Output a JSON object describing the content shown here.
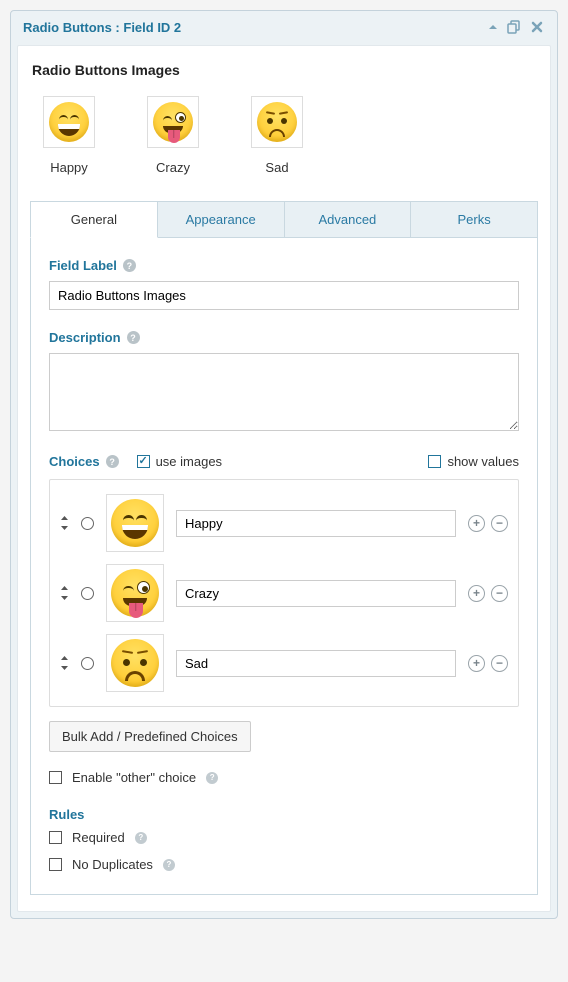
{
  "header": {
    "title": "Radio Buttons : Field ID 2"
  },
  "field": {
    "title": "Radio Buttons Images"
  },
  "preview": {
    "items": [
      {
        "label": "Happy",
        "icon": "happy"
      },
      {
        "label": "Crazy",
        "icon": "crazy"
      },
      {
        "label": "Sad",
        "icon": "sad"
      }
    ]
  },
  "tabs": {
    "general": "General",
    "appearance": "Appearance",
    "advanced": "Advanced",
    "perks": "Perks",
    "active": "general"
  },
  "general": {
    "field_label_title": "Field Label",
    "field_label_value": "Radio Buttons Images",
    "description_title": "Description",
    "description_value": "",
    "choices_title": "Choices",
    "use_images_label": "use images",
    "use_images_checked": true,
    "show_values_label": "show values",
    "show_values_checked": false,
    "choices": [
      {
        "label": "Happy",
        "icon": "happy"
      },
      {
        "label": "Crazy",
        "icon": "crazy"
      },
      {
        "label": "Sad",
        "icon": "sad"
      }
    ],
    "bulk_button": "Bulk Add / Predefined Choices",
    "enable_other_label": "Enable \"other\" choice",
    "enable_other_checked": false,
    "rules_title": "Rules",
    "required_label": "Required",
    "required_checked": false,
    "no_duplicates_label": "No Duplicates",
    "no_duplicates_checked": false
  }
}
